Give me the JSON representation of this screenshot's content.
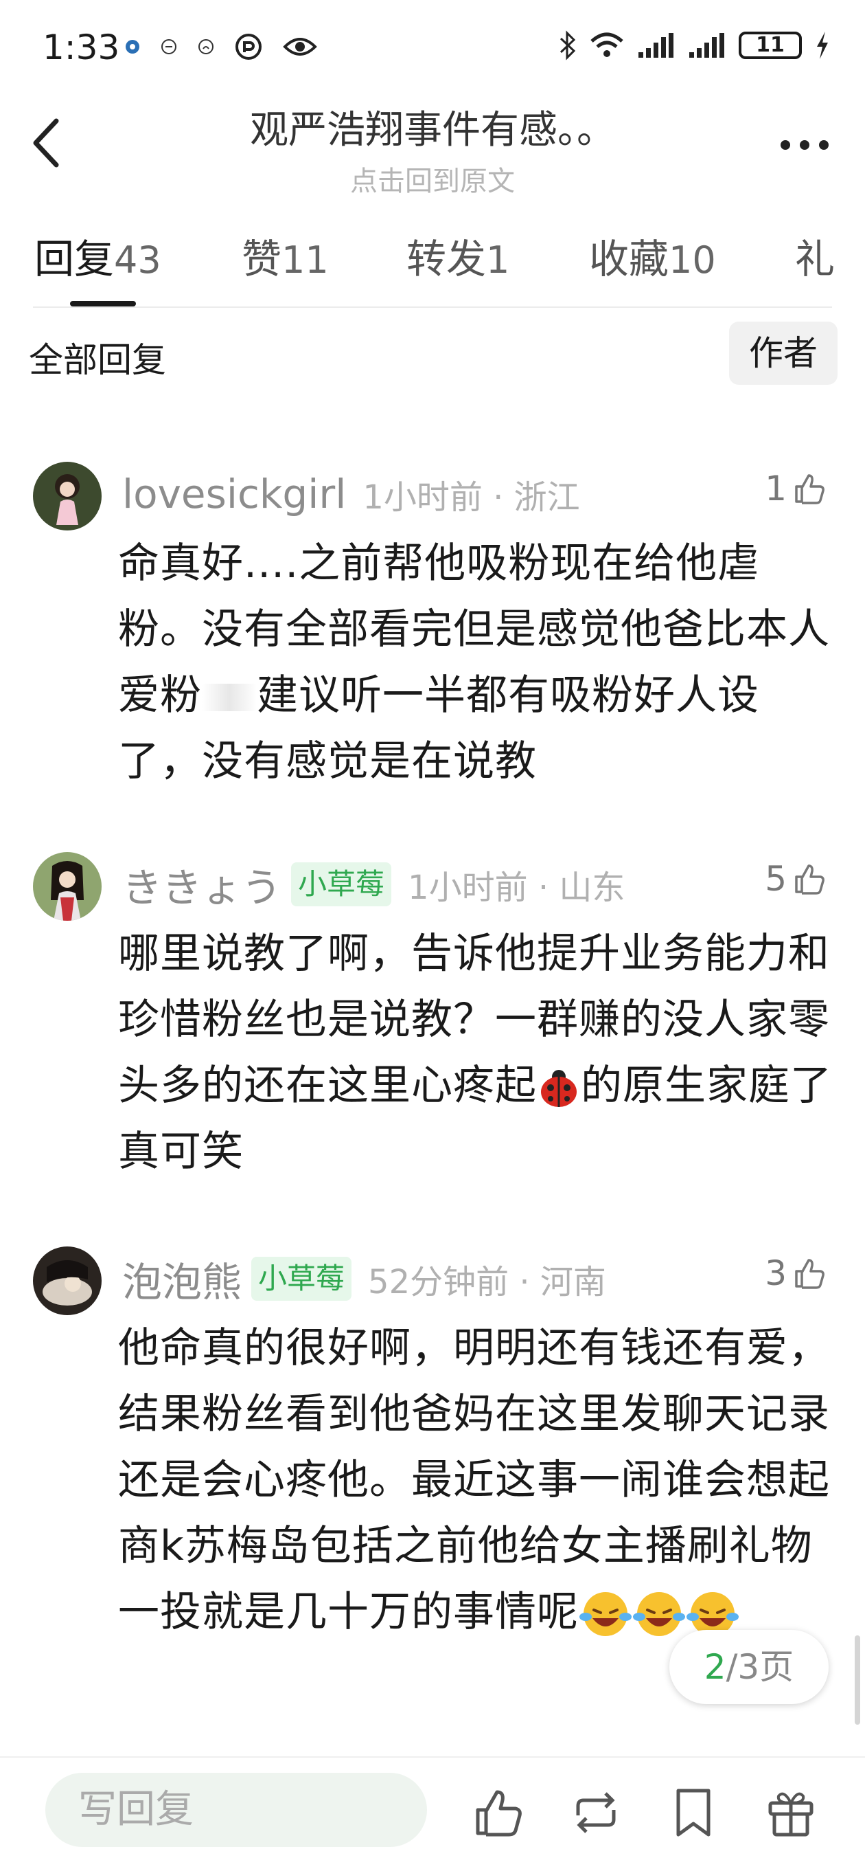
{
  "status_bar": {
    "time": "1:33",
    "battery": "11",
    "left_icons": [
      "app-notification-icon",
      "notification-icon",
      "notification-icon",
      "app-notification-icon",
      "eye-icon"
    ],
    "right_icons": [
      "bluetooth-icon",
      "wifi-icon",
      "signal-icon",
      "signal-icon",
      "battery-icon",
      "charging-icon"
    ]
  },
  "header": {
    "title": "观严浩翔事件有感。。",
    "subtitle": "点击回到原文"
  },
  "tabs": [
    {
      "label": "回复",
      "count": "43",
      "active": true
    },
    {
      "label": "赞",
      "count": "11",
      "active": false
    },
    {
      "label": "转发",
      "count": "1",
      "active": false
    },
    {
      "label": "收藏",
      "count": "10",
      "active": false
    },
    {
      "label": "礼",
      "count": "",
      "active": false
    }
  ],
  "filter": {
    "all_label": "全部回复",
    "author_label": "作者"
  },
  "comments": [
    {
      "username": "lovesickgirl",
      "badge": "",
      "time": "1小时前",
      "location": "浙江",
      "likes": "1",
      "content": "命真好....之前帮他吸粉现在给他虐粉。没有全部看完但是感觉他爸比本人爱粉",
      "content_2": "建议听一半都有吸粉好人设了，没有感觉是在说教"
    },
    {
      "username": "ききょう",
      "badge": "小草莓",
      "time": "1小时前",
      "location": "山东",
      "likes": "5",
      "content": "哪里说教了啊，告诉他提升业务能力和珍惜粉丝也是说教？一群赚的没人家零头多的还在这里心疼起",
      "content_2": "的原生家庭了真可笑"
    },
    {
      "username": "泡泡熊",
      "badge": "小草莓",
      "time": "52分钟前",
      "location": "河南",
      "likes": "3",
      "content": "他命真的很好啊，明明还有钱还有爱，结果粉丝看到他爸妈在这里发聊天记录还是会心疼他。最近这事一闹谁会想起商k苏梅岛包括之前他给女主播刷礼物一投就是几十万的事情呢"
    }
  ],
  "pagination": {
    "current": "2",
    "total_text": "/3页"
  },
  "bottom_bar": {
    "reply_placeholder": "写回复"
  },
  "colors": {
    "badge_green": "#2fa84f",
    "badge_bg": "#e6f7ea",
    "input_bg": "#eef4ef"
  }
}
